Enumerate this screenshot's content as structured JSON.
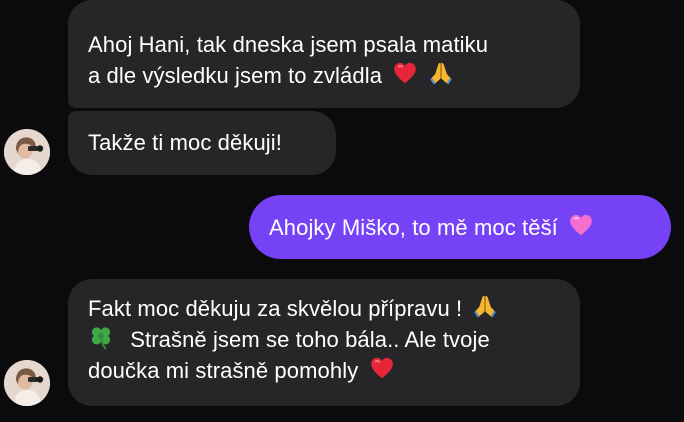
{
  "messages": [
    {
      "id": "m1",
      "direction": "incoming",
      "lines": [
        "Ahoj Hani, tak dneska jsem psala matiku",
        "a dle výsledku jsem to zvládla"
      ],
      "emojis": [
        "heart-emoji",
        "praying-hands-emoji"
      ]
    },
    {
      "id": "m2",
      "direction": "incoming",
      "lines": [
        "Takže ti moc děkuji!"
      ]
    },
    {
      "id": "m3",
      "direction": "outgoing",
      "lines": [
        "Ahojky Miško, to mě moc těší"
      ],
      "emojis": [
        "pink-heart-emoji"
      ]
    },
    {
      "id": "m4",
      "direction": "incoming",
      "lines": [
        "Fakt moc děkuju za skvělou přípravu !",
        "Strašně jsem se toho bála.. Ale tvoje",
        "doučka mi strašně pomohly"
      ],
      "emojis": [
        "praying-hands-emoji",
        "four-leaf-clover-emoji",
        "heart-emoji"
      ]
    }
  ],
  "colors": {
    "background": "#0b0b0d",
    "incoming_bubble": "#262628",
    "outgoing_bubble": "#7543f5",
    "text": "#ffffff"
  }
}
